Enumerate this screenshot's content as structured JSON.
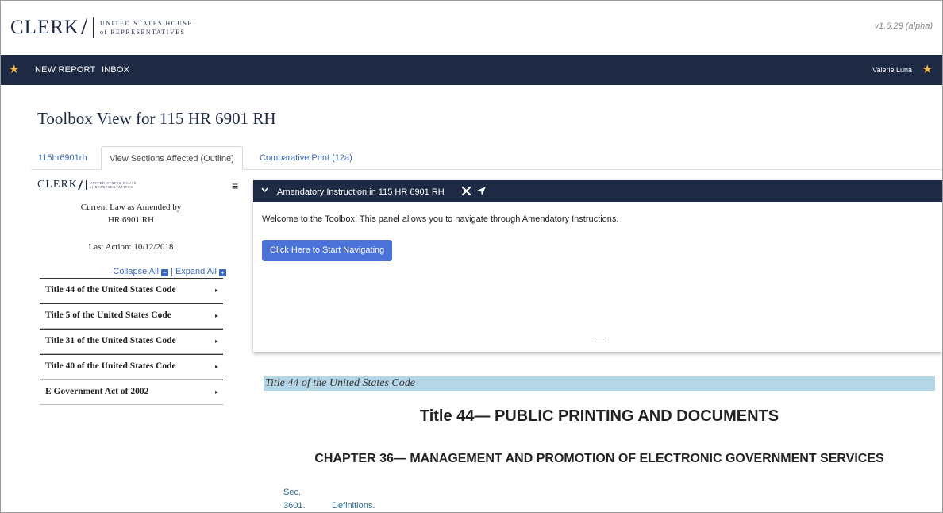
{
  "header": {
    "logo_word": "CLERK",
    "logo_line1": "UNITED STATES HOUSE",
    "logo_line2": "of REPRESENTATIVES",
    "version": "v1.6.29 (alpha)"
  },
  "nav": {
    "new_report": "NEW REPORT",
    "inbox": "INBOX",
    "user": "Valerie Luna"
  },
  "page": {
    "title": "Toolbox View for 115 HR 6901 RH"
  },
  "tabs": [
    {
      "label": "115hr6901rh"
    },
    {
      "label": "View Sections Affected (Outline)"
    },
    {
      "label": "Comparative Print (12a)"
    }
  ],
  "sidebar": {
    "logo_word": "CLERK",
    "logo_line1": "UNITED STATES HOUSE",
    "logo_line2": "of REPRESENTATIVES",
    "menu_icon": "hamburger-icon",
    "current_law_line1": "Current Law as Amended by",
    "current_law_line2": "HR 6901 RH",
    "last_action": "Last Action: 10/12/2018",
    "collapse_all": "Collapse All",
    "expand_all": "Expand All",
    "separator": "|",
    "items": [
      {
        "label": "Title 44 of the United States Code"
      },
      {
        "label": "Title 5 of the United States Code"
      },
      {
        "label": "Title 31 of the United States Code"
      },
      {
        "label": "Title 40 of the United States Code"
      },
      {
        "label": "E Government Act of 2002"
      }
    ]
  },
  "panel": {
    "title": "Amendatory Instruction in 115 HR 6901 RH",
    "welcome": "Welcome to the Toolbox! This panel allows you to navigate through Amendatory Instructions.",
    "start_button": "Click Here to Start Navigating",
    "icons": [
      "tools-icon",
      "send-icon"
    ]
  },
  "document": {
    "banner": "Title 44 of the United States Code",
    "title": "Title 44— PUBLIC PRINTING AND DOCUMENTS",
    "chapter": "CHAPTER 36— MANAGEMENT AND PROMOTION OF ELECTRONIC GOVERNMENT SERVICES",
    "sec_label": "Sec.",
    "sec_number": "3601.",
    "sec_title": "Definitions."
  },
  "colors": {
    "navy": "#1e2a44",
    "star": "#f2b84b",
    "link": "#3a67b8",
    "button": "#4a72d8",
    "banner": "#b5d6e6"
  }
}
